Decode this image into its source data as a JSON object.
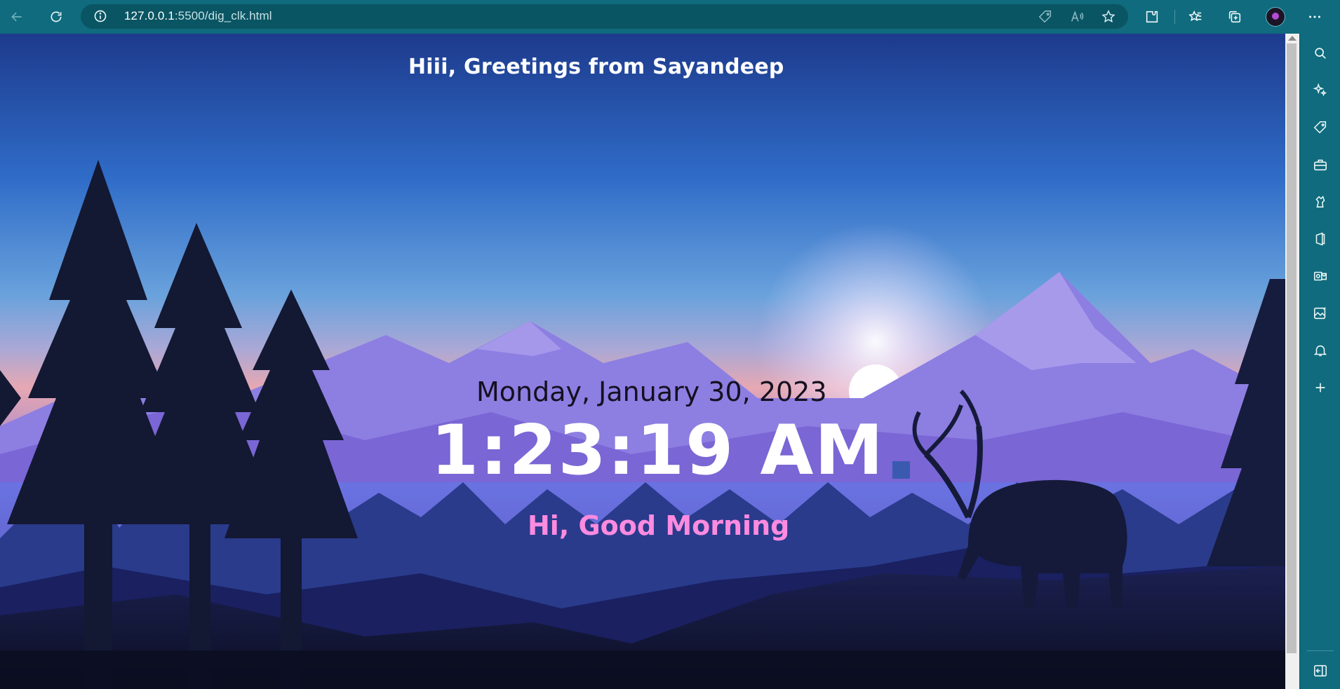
{
  "browser": {
    "url_host": "127.0.0.1",
    "url_path": ":5500/dig_clk.html",
    "icons": {
      "back": "back-arrow-icon",
      "refresh": "refresh-icon",
      "info": "info-icon",
      "tag": "tag-icon",
      "read_aloud": "read-aloud-icon",
      "favorite_add": "add-favorite-icon",
      "extensions": "extensions-icon",
      "favorites": "favorites-icon",
      "collections": "collections-icon",
      "profile": "avatar",
      "more": "more-icon"
    }
  },
  "page": {
    "greeting": "Hiii, Greetings from Sayandeep",
    "date": "Monday, January 30, 2023",
    "time": "1:23:19 AM",
    "salutation": "Hi, Good Morning",
    "colors": {
      "greeting_text": "#ffffff",
      "date_text": "#15101f",
      "time_text": "#ffffff",
      "salutation_text": "#ff8be0",
      "indicator_square": "#3a5ab0",
      "sky_top": "#1e3a8a",
      "sky_mid": "#3c85d4",
      "horizon": "#e9a3b0",
      "mountains": "#8672d8",
      "forest": "#121a3a"
    }
  },
  "sidebar": {
    "icons": [
      "search-icon",
      "copilot-icon",
      "shopping-tag-icon",
      "tools-icon",
      "games-icon",
      "office-icon",
      "outlook-icon",
      "image-creator-icon",
      "bell-icon",
      "add-icon",
      "hide-sidebar-icon"
    ]
  }
}
